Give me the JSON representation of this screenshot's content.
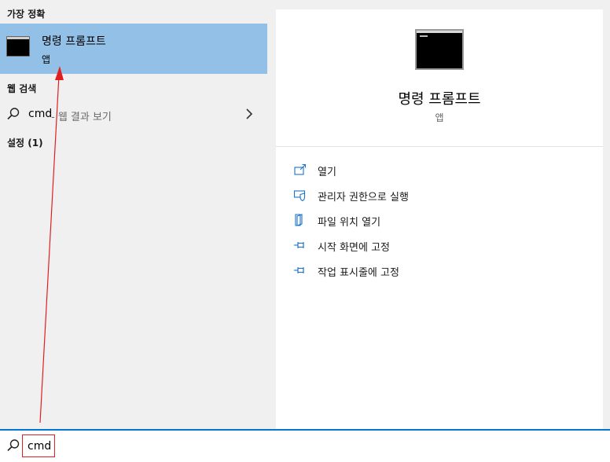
{
  "left": {
    "best_match_title": "가장 정확",
    "best_match": {
      "name": "명령 프롬프트",
      "type": "앱",
      "icon": "cmd-app-icon"
    },
    "web_section_title": "웹 검색",
    "web_result": {
      "query": "cmd",
      "suffix": "- 웹 결과 보기",
      "icon": "search-icon"
    },
    "settings_section_title": "설정 (1)"
  },
  "right": {
    "app_name": "명령 프롬프트",
    "app_type": "앱",
    "actions": [
      {
        "label": "열기",
        "icon": "open-icon"
      },
      {
        "label": "관리자 권한으로 실행",
        "icon": "admin-shield-icon"
      },
      {
        "label": "파일 위치 열기",
        "icon": "file-location-icon"
      },
      {
        "label": "시작 화면에 고정",
        "icon": "pin-icon"
      },
      {
        "label": "작업 표시줄에 고정",
        "icon": "pin-icon"
      }
    ]
  },
  "search": {
    "value": "cmd",
    "icon": "search-icon"
  },
  "colors": {
    "selected_bg": "#92c0e6",
    "accent_blue": "#0078d7",
    "annotation_red": "#e02020"
  }
}
